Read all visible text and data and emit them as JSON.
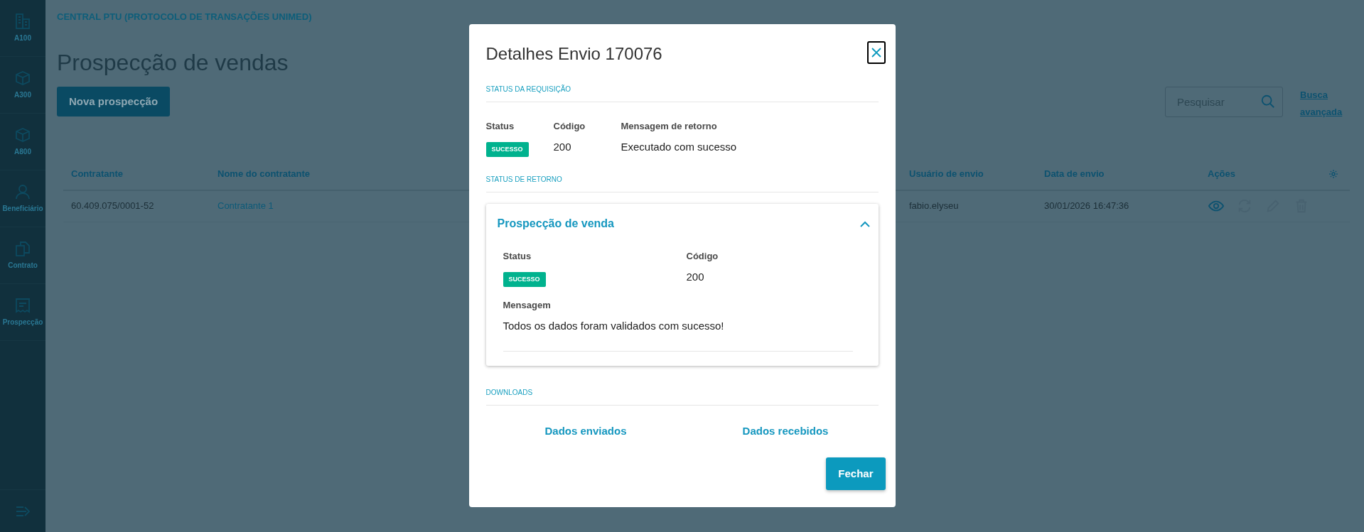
{
  "sidebar": {
    "items": [
      {
        "label": "A100"
      },
      {
        "label": "A300"
      },
      {
        "label": "A800"
      },
      {
        "label": "Beneficiário"
      },
      {
        "label": "Contrato"
      },
      {
        "label": "Prospecção"
      }
    ]
  },
  "app_title": "CENTRAL PTU (PROTOCOLO DE TRANSAÇÕES UNIMED)",
  "page_title": "Prospecção de vendas",
  "new_button": "Nova prospecção",
  "search": {
    "placeholder": "Pesquisar"
  },
  "advanced_search": "Busca avançada",
  "table": {
    "columns": [
      {
        "label": "Contratante"
      },
      {
        "label": "Nome do contratante"
      },
      {
        "label": "Usuário de envio"
      },
      {
        "label": "Data de envio"
      },
      {
        "label": "Ações"
      }
    ],
    "rows": [
      {
        "cells": [
          "60.409.075/0001-52",
          "Contratante 1",
          "fabio.elyseu",
          "30/01/2026 16:47:36"
        ],
        "actions": [
          {
            "disabled": false
          },
          {
            "disabled": true
          },
          {
            "disabled": true
          },
          {
            "disabled": true
          }
        ]
      }
    ]
  },
  "modal": {
    "title": "Detalhes Envio 170076",
    "request_section": {
      "heading": "STATUS DA REQUISIÇÃO",
      "status_label": "Status",
      "status": "SUCESSO",
      "code_label": "Código",
      "code": "200",
      "message_label": "Mensagem de retorno",
      "message": "Executado com sucesso"
    },
    "return_section": {
      "heading": "STATUS DE RETORNO",
      "panels": [
        {
          "title": "Prospecção de venda",
          "expanded": true,
          "status_label": "Status",
          "status": "SUCESSO",
          "code_label": "Código",
          "code": "200",
          "message_label": "Mensagem",
          "message": "Todos os dados foram validados com sucesso!"
        }
      ]
    },
    "downloads": {
      "heading": "DOWNLOADS",
      "links": [
        "Dados enviados",
        "Dados recebidos"
      ]
    },
    "close_button": "Fechar"
  }
}
